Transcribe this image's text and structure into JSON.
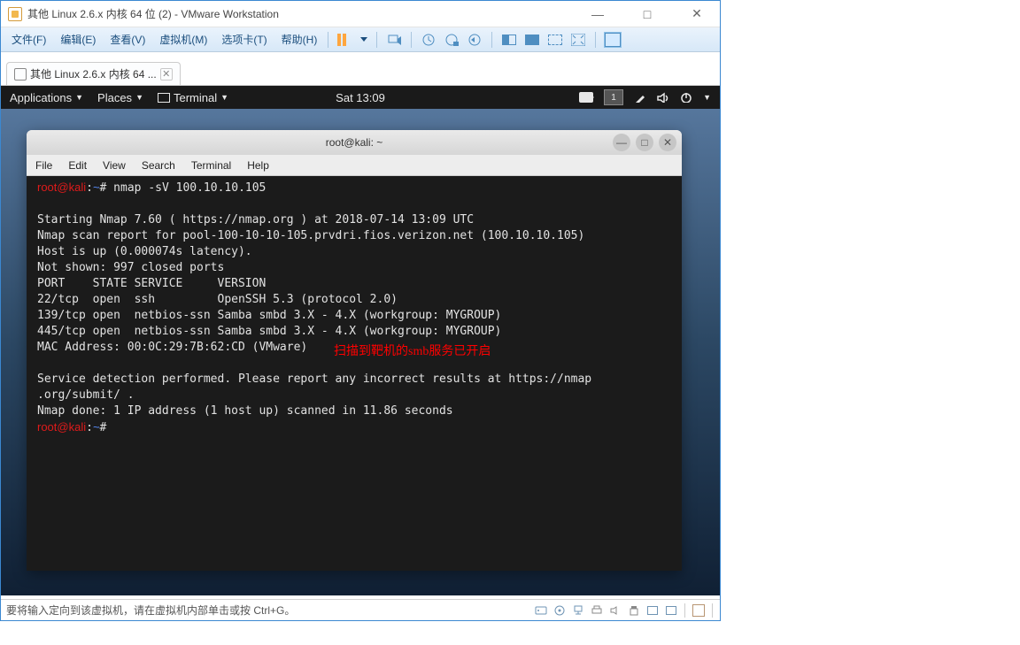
{
  "window": {
    "title": "其他 Linux 2.6.x 内核 64 位 (2) - VMware Workstation"
  },
  "menu": {
    "file": "文件(F)",
    "edit": "编辑(E)",
    "view": "查看(V)",
    "vm": "虚拟机(M)",
    "tabs": "选项卡(T)",
    "help": "帮助(H)"
  },
  "tab": {
    "label": "其他 Linux 2.6.x 内核 64 ..."
  },
  "gnome": {
    "applications": "Applications",
    "places": "Places",
    "terminal": "Terminal",
    "clock": "Sat 13:09",
    "workspace": "1"
  },
  "terminal": {
    "title": "root@kali: ~",
    "menu": {
      "file": "File",
      "edit": "Edit",
      "view": "View",
      "search": "Search",
      "terminal": "Terminal",
      "help": "Help"
    },
    "prompt1": {
      "user": "root@kali",
      "path": "~",
      "symbol": "#",
      "cmd": "nmap -sV 100.10.10.105"
    },
    "lines": [
      "",
      "Starting Nmap 7.60 ( https://nmap.org ) at 2018-07-14 13:09 UTC",
      "Nmap scan report for pool-100-10-10-105.prvdri.fios.verizon.net (100.10.10.105)",
      "Host is up (0.000074s latency).",
      "Not shown: 997 closed ports",
      "PORT    STATE SERVICE     VERSION",
      "22/tcp  open  ssh         OpenSSH 5.3 (protocol 2.0)",
      "139/tcp open  netbios-ssn Samba smbd 3.X - 4.X (workgroup: MYGROUP)",
      "445/tcp open  netbios-ssn Samba smbd 3.X - 4.X (workgroup: MYGROUP)",
      "MAC Address: 00:0C:29:7B:62:CD (VMware)",
      "",
      "Service detection performed. Please report any incorrect results at https://nmap",
      ".org/submit/ .",
      "Nmap done: 1 IP address (1 host up) scanned in 11.86 seconds"
    ],
    "prompt2": {
      "user": "root@kali",
      "path": "~",
      "symbol": "#"
    },
    "annotation": "扫描到靶机的smb服务已开启"
  },
  "status": {
    "text": "要将输入定向到该虚拟机，请在虚拟机内部单击或按 Ctrl+G。"
  }
}
